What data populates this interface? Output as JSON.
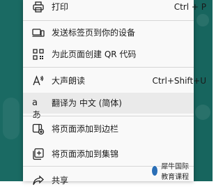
{
  "menu": {
    "items": [
      {
        "label": "打印",
        "shortcut": "Ctrl + P",
        "icon": "printer-icon"
      },
      {
        "label": "发送标签页到你的设备",
        "icon": "send-to-devices-icon"
      },
      {
        "label": "为此页面创建 QR 代码",
        "icon": "qr-code-icon"
      },
      {
        "label": "大声朗读",
        "shortcut": "Ctrl+Shift+U",
        "icon": "read-aloud-icon"
      },
      {
        "label": "翻译为 中文 (简体)",
        "icon": "translate-icon",
        "icon_text": "aあ"
      },
      {
        "label": "将页面添加到边栏",
        "icon": "add-to-sidebar-icon"
      },
      {
        "label": "将页面添加到集锦",
        "icon": "add-to-collections-icon"
      },
      {
        "label": "共享",
        "icon": "share-icon"
      }
    ]
  },
  "watermark": {
    "text": "犀牛国际教育课程"
  },
  "colors": {
    "menu_bg": "#f9f9f9",
    "hover_bg": "#eaeaea",
    "background_teal": "#1a6a63"
  }
}
